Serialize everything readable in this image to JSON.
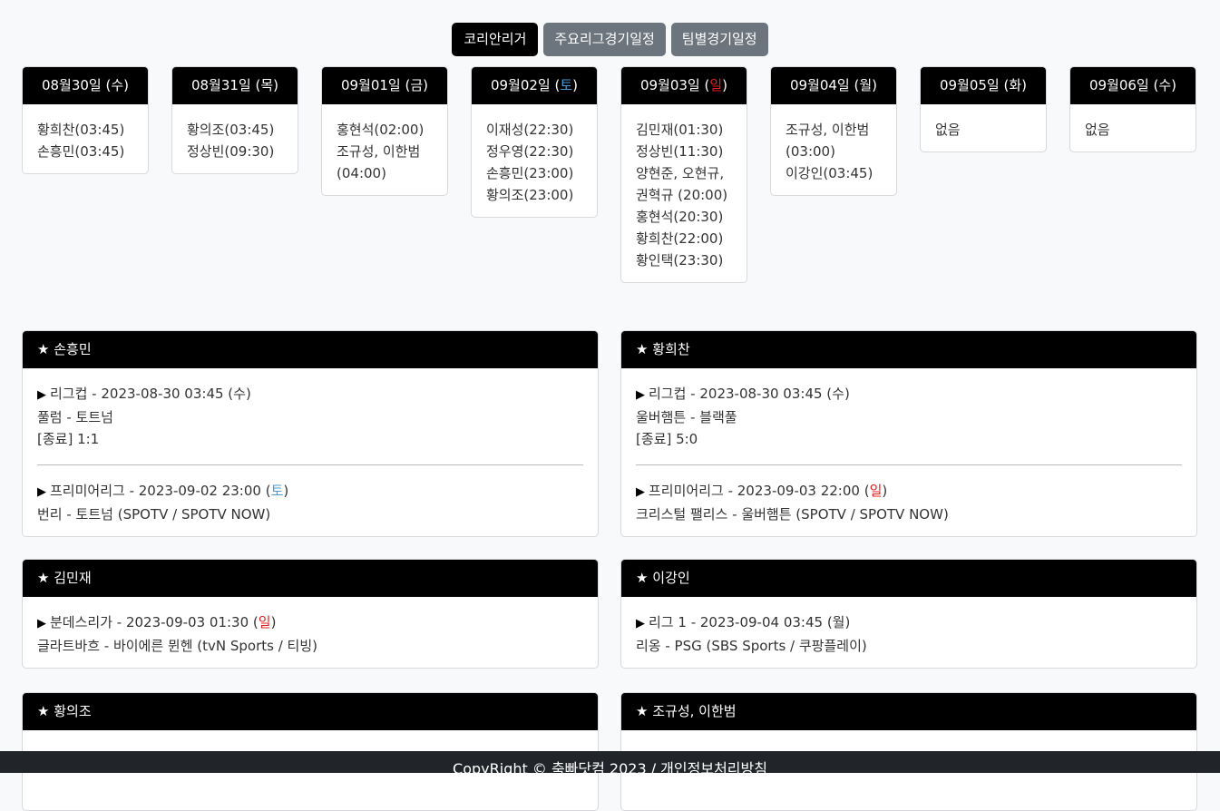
{
  "tabs": [
    {
      "label": "코리안리거",
      "active": true
    },
    {
      "label": "주요리그경기일정",
      "active": false
    },
    {
      "label": "팀별경기일정",
      "active": false
    }
  ],
  "days": [
    {
      "date": "08월30일",
      "weekday": "수",
      "weekday_type": "normal",
      "entries": [
        "황희찬(03:45)",
        "손흥민(03:45)"
      ]
    },
    {
      "date": "08월31일",
      "weekday": "목",
      "weekday_type": "normal",
      "entries": [
        "황의조(03:45)",
        "정상빈(09:30)"
      ]
    },
    {
      "date": "09월01일",
      "weekday": "금",
      "weekday_type": "normal",
      "entries": [
        "홍현석(02:00)",
        "조규성, 이한범 (04:00)"
      ]
    },
    {
      "date": "09월02일",
      "weekday": "토",
      "weekday_type": "sat",
      "entries": [
        "이재성(22:30)",
        "정우영(22:30)",
        "손흥민(23:00)",
        "황의조(23:00)"
      ]
    },
    {
      "date": "09월03일",
      "weekday": "일",
      "weekday_type": "sun",
      "entries": [
        "김민재(01:30)",
        "정상빈(11:30)",
        "양현준, 오현규, 권혁규 (20:00)",
        "홍현석(20:30)",
        "황희찬(22:00)",
        "황인택(23:30)"
      ]
    },
    {
      "date": "09월04일",
      "weekday": "월",
      "weekday_type": "normal",
      "entries": [
        "조규성, 이한범 (03:00)",
        "이강인(03:45)"
      ]
    },
    {
      "date": "09월05일",
      "weekday": "화",
      "weekday_type": "normal",
      "entries": [
        "없음"
      ]
    },
    {
      "date": "09월06일",
      "weekday": "수",
      "weekday_type": "normal",
      "entries": [
        "없음"
      ]
    }
  ],
  "players": [
    {
      "name": "손흥민",
      "games": [
        {
          "league": "리그컵",
          "datetime": "2023-08-30 03:45",
          "weekday": "수",
          "weekday_type": "normal",
          "match": "풀럼 - 토트넘",
          "extra": "[종료] 1:1"
        },
        {
          "league": "프리미어리그",
          "datetime": "2023-09-02 23:00",
          "weekday": "토",
          "weekday_type": "sat",
          "match": "번리 - 토트넘 (SPOTV / SPOTV NOW)",
          "extra": ""
        }
      ]
    },
    {
      "name": "황희찬",
      "games": [
        {
          "league": "리그컵",
          "datetime": "2023-08-30 03:45",
          "weekday": "수",
          "weekday_type": "normal",
          "match": "울버햄튼 - 블랙풀",
          "extra": "[종료] 5:0"
        },
        {
          "league": "프리미어리그",
          "datetime": "2023-09-03 22:00",
          "weekday": "일",
          "weekday_type": "sun",
          "match": "크리스털 팰리스 - 울버햄튼 (SPOTV / SPOTV NOW)",
          "extra": ""
        }
      ]
    },
    {
      "name": "김민재",
      "games": [
        {
          "league": "분데스리가",
          "datetime": "2023-09-03 01:30",
          "weekday": "일",
          "weekday_type": "sun",
          "match": "글라트바흐 - 바이에른 뮌헨 (tvN Sports / 티빙)",
          "extra": ""
        }
      ]
    },
    {
      "name": "이강인",
      "games": [
        {
          "league": "리그 1",
          "datetime": "2023-09-04 03:45",
          "weekday": "월",
          "weekday_type": "normal",
          "match": "리옹 - PSG (SBS Sports / 쿠팡플레이)",
          "extra": ""
        }
      ]
    },
    {
      "name": "황의조",
      "games": []
    },
    {
      "name": "조규성, 이한범",
      "games": []
    }
  ],
  "footer": {
    "text": "CopyRight © 축빠닷컴 2023 / 개인정보처리방침"
  },
  "colors": {
    "saturday": "#4a9bd8",
    "sunday": "#e02020",
    "header_bg": "#000000",
    "footer_bg": "#212529"
  },
  "icons": {
    "player_marker": "star-icon",
    "game_marker": "play-triangle-icon"
  }
}
